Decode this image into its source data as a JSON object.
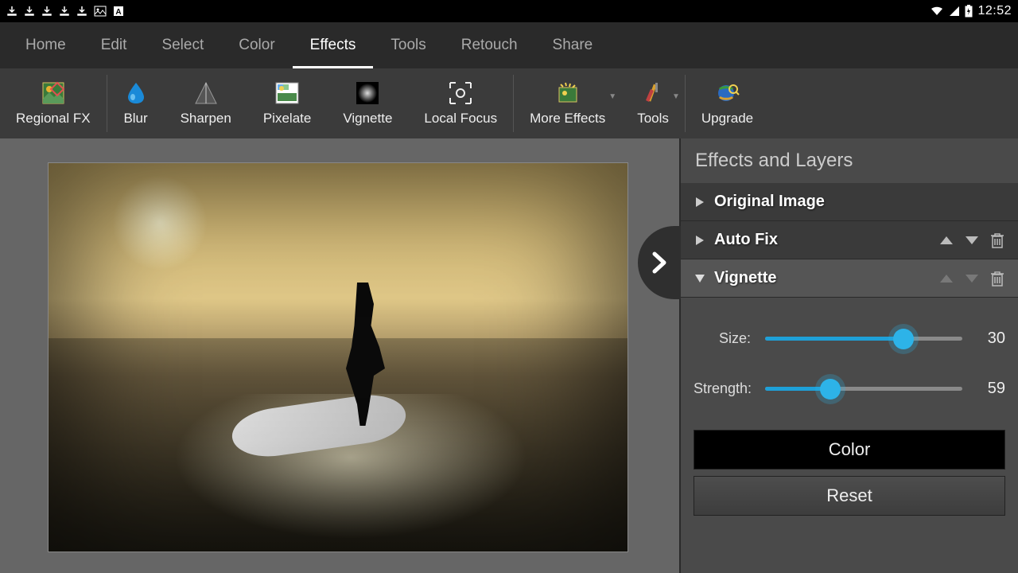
{
  "status": {
    "time": "12:52"
  },
  "menu": {
    "items": [
      "Home",
      "Edit",
      "Select",
      "Color",
      "Effects",
      "Tools",
      "Retouch",
      "Share"
    ],
    "active_index": 4
  },
  "toolbar": {
    "items": [
      {
        "label": "Regional FX",
        "icon": "regional-fx-icon"
      },
      {
        "label": "Blur",
        "icon": "blur-icon"
      },
      {
        "label": "Sharpen",
        "icon": "sharpen-icon"
      },
      {
        "label": "Pixelate",
        "icon": "pixelate-icon"
      },
      {
        "label": "Vignette",
        "icon": "vignette-icon"
      },
      {
        "label": "Local Focus",
        "icon": "local-focus-icon"
      },
      {
        "label": "More Effects",
        "icon": "more-effects-icon",
        "dropdown": true
      },
      {
        "label": "Tools",
        "icon": "tools-icon",
        "dropdown": true
      },
      {
        "label": "Upgrade",
        "icon": "upgrade-icon"
      }
    ]
  },
  "panel": {
    "title": "Effects and Layers",
    "layers": [
      {
        "name": "Original Image",
        "expanded": false,
        "controls": false
      },
      {
        "name": "Auto Fix",
        "expanded": false,
        "controls": true
      },
      {
        "name": "Vignette",
        "expanded": true,
        "controls": true,
        "selected": true
      }
    ],
    "sliders": {
      "size": {
        "label": "Size:",
        "value": 30,
        "percent": 70
      },
      "strength": {
        "label": "Strength:",
        "value": 59,
        "percent": 33
      }
    },
    "buttons": {
      "color": "Color",
      "reset": "Reset"
    }
  }
}
